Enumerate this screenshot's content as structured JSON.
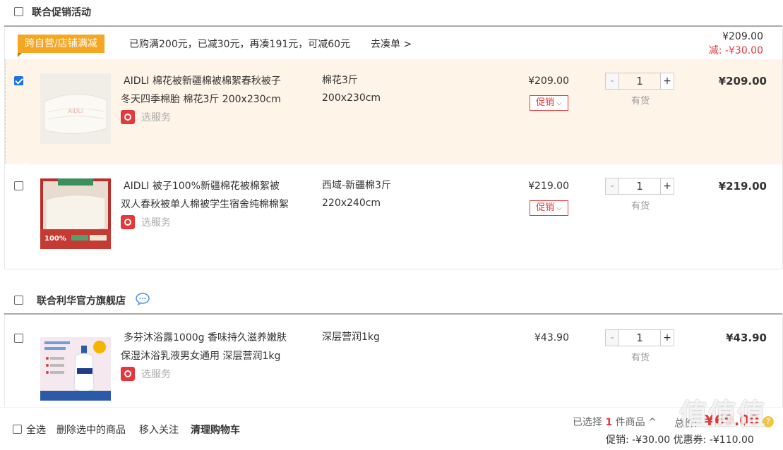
{
  "header": {
    "title": "联合促销活动"
  },
  "group1": {
    "tag": "跨自营/店铺满减",
    "promo_text": "已购满200元，已减30元，再凑191元，可减60元",
    "promo_link": "去凑单 >",
    "total": "¥209.00",
    "discount": "减: -¥30.00"
  },
  "items": [
    {
      "title_line1": "AIDLI 棉花被新疆棉被棉絮春秋被子",
      "title_line2": "冬天四季棉胎 棉花3斤 200x230cm",
      "service": "选服务",
      "spec1": "棉花3斤",
      "spec2": "200x230cm",
      "price": "¥209.00",
      "promo": "促销",
      "qty": "1",
      "stock": "有货",
      "subtotal": "¥209.00"
    },
    {
      "title_line1": "AIDLI 被子100%新疆棉花被棉絮被",
      "title_line2": "双人春秋被单人棉被学生宿舍纯棉棉絮",
      "service": "选服务",
      "spec1": "西域-新疆棉3斤",
      "spec2": "220x240cm",
      "price": "¥219.00",
      "promo": "促销",
      "qty": "1",
      "stock": "有货",
      "subtotal": "¥219.00",
      "thumb_badge": "100%"
    },
    {
      "title_line1": "多芬沐浴露1000g 香味持久滋养嫩肤",
      "title_line2": "保湿沐浴乳液男女通用 深层营润1kg",
      "service": "选服务",
      "spec1": "深层营润1kg",
      "price": "¥43.90",
      "qty": "1",
      "stock": "有货",
      "subtotal": "¥43.90"
    }
  ],
  "shop2": {
    "title": "联合利华官方旗舰店"
  },
  "qty_buttons": {
    "minus": "-",
    "plus": "+"
  },
  "footer": {
    "select_all": "全选",
    "delete_selected": "删除选中的商品",
    "move_follow": "移入关注",
    "clear_cart": "清理购物车",
    "selected_prefix": "已选择",
    "selected_count": "1",
    "selected_suffix": "件商品",
    "total_label": "总价:",
    "total_value": "¥69.00",
    "promo_line": "促销: -¥30.00 优惠券: -¥110.00"
  },
  "watermark": "值值值",
  "colors": {
    "accent_red": "#e4393c",
    "tag_orange": "#f5a623",
    "selected_row_bg": "#fff4e8",
    "checkbox_blue": "#1a73e8"
  }
}
